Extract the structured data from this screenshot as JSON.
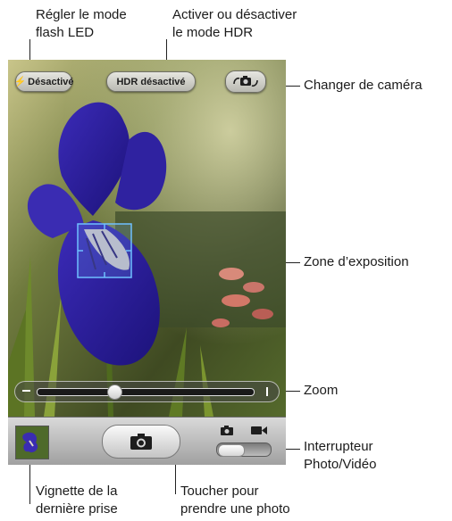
{
  "callouts": {
    "flash": [
      "Régler le mode",
      "flash LED"
    ],
    "hdr": [
      "Activer ou désactiver",
      "le mode HDR"
    ],
    "camera_switch": "Changer de caméra",
    "exposure": "Zone d’exposition",
    "zoom": "Zoom",
    "photo_video": [
      "Interrupteur",
      "Photo/Vidéo"
    ],
    "thumbnail": [
      "Vignette de la",
      "dernière prise"
    ],
    "shutter": [
      "Toucher pour",
      "prendre une photo"
    ]
  },
  "camera": {
    "flash_label": "Désactivé",
    "hdr_label": "HDR désactivé",
    "zoom_level": 0.35,
    "mode": "photo"
  },
  "icons": {
    "flash": "lightning-bolt-icon",
    "switch_camera": "switch-camera-icon",
    "shutter": "camera-icon",
    "photo_mode": "camera-small-icon",
    "video_mode": "video-camera-icon",
    "zoom_out": "minus-icon",
    "zoom_in": "plus-icon"
  }
}
